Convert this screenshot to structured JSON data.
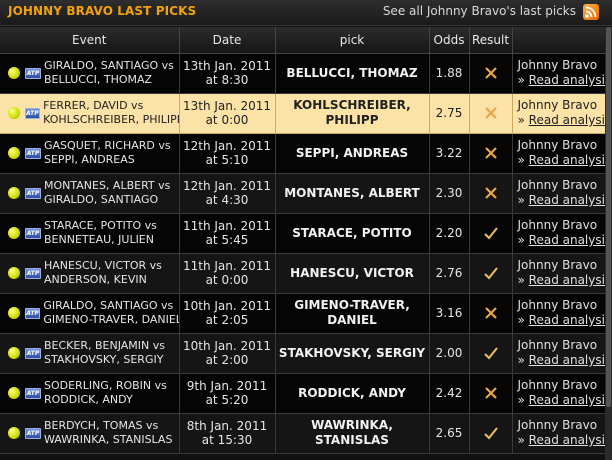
{
  "header": {
    "title": "JOHNNY BRAVO LAST PICKS",
    "see_all": "See all Johnny Bravo's last picks",
    "rss_icon": "rss-icon"
  },
  "columns": [
    "Event",
    "Date",
    "pick",
    "Odds",
    "Result",
    ""
  ],
  "colors": {
    "accent": "#f2a20c",
    "highlight_row": "#fbe2a6",
    "win": "#e8c15a",
    "loss": "#e8a54a"
  },
  "rows": [
    {
      "event1": "GIRALDO, SANTIAGO vs",
      "event2": "BELLUCCI, THOMAZ",
      "date1": "13th Jan. 2011",
      "date2": "at 8:30",
      "pick1": "BELLUCCI, THOMAZ",
      "pick2": "",
      "odds": "1.88",
      "result": "loss",
      "analyst": "Johnny Bravo",
      "link": "Read analysis"
    },
    {
      "event1": "FERRER, DAVID vs",
      "event2": "KOHLSCHREIBER, PHILIPP",
      "date1": "13th Jan. 2011",
      "date2": "at 0:00",
      "pick1": "KOHLSCHREIBER,",
      "pick2": "PHILIPP",
      "odds": "2.75",
      "result": "loss",
      "analyst": "Johnny Bravo",
      "link": "Read analysis",
      "highlight": true
    },
    {
      "event1": "GASQUET, RICHARD vs",
      "event2": "SEPPI, ANDREAS",
      "date1": "12th Jan. 2011",
      "date2": "at 5:10",
      "pick1": "SEPPI, ANDREAS",
      "pick2": "",
      "odds": "3.22",
      "result": "loss",
      "analyst": "Johnny Bravo",
      "link": "Read analysis"
    },
    {
      "event1": "MONTANES, ALBERT vs",
      "event2": "GIRALDO, SANTIAGO",
      "date1": "12th Jan. 2011",
      "date2": "at 4:30",
      "pick1": "MONTANES, ALBERT",
      "pick2": "",
      "odds": "2.30",
      "result": "loss",
      "analyst": "Johnny Bravo",
      "link": "Read analysis"
    },
    {
      "event1": "STARACE, POTITO vs",
      "event2": "BENNETEAU, JULIEN",
      "date1": "11th Jan. 2011",
      "date2": "at 5:45",
      "pick1": "STARACE, POTITO",
      "pick2": "",
      "odds": "2.20",
      "result": "win",
      "analyst": "Johnny Bravo",
      "link": "Read analysis"
    },
    {
      "event1": "HANESCU, VICTOR vs",
      "event2": "ANDERSON, KEVIN",
      "date1": "11th Jan. 2011",
      "date2": "at 0:00",
      "pick1": "HANESCU, VICTOR",
      "pick2": "",
      "odds": "2.76",
      "result": "win",
      "analyst": "Johnny Bravo",
      "link": "Read analysis"
    },
    {
      "event1": "GIRALDO, SANTIAGO vs",
      "event2": "GIMENO-TRAVER, DANIEL",
      "date1": "10th Jan. 2011",
      "date2": "at 2:05",
      "pick1": "GIMENO-TRAVER,",
      "pick2": "DANIEL",
      "odds": "3.16",
      "result": "loss",
      "analyst": "Johnny Bravo",
      "link": "Read analysis"
    },
    {
      "event1": "BECKER, BENJAMIN vs",
      "event2": "STAKHOVSKY, SERGIY",
      "date1": "10th Jan. 2011",
      "date2": "at 2:00",
      "pick1": "STAKHOVSKY, SERGIY",
      "pick2": "",
      "odds": "2.00",
      "result": "win",
      "analyst": "Johnny Bravo",
      "link": "Read analysis"
    },
    {
      "event1": "SODERLING, ROBIN vs",
      "event2": "RODDICK, ANDY",
      "date1": "9th Jan. 2011",
      "date2": "at 5:20",
      "pick1": "RODDICK, ANDY",
      "pick2": "",
      "odds": "2.42",
      "result": "loss",
      "analyst": "Johnny Bravo",
      "link": "Read analysis"
    },
    {
      "event1": "BERDYCH, TOMAS vs",
      "event2": "WAWRINKA, STANISLAS",
      "date1": "8th Jan. 2011",
      "date2": "at 15:30",
      "pick1": "WAWRINKA,",
      "pick2": "STANISLAS",
      "odds": "2.65",
      "result": "win",
      "analyst": "Johnny Bravo",
      "link": "Read analysis"
    }
  ]
}
